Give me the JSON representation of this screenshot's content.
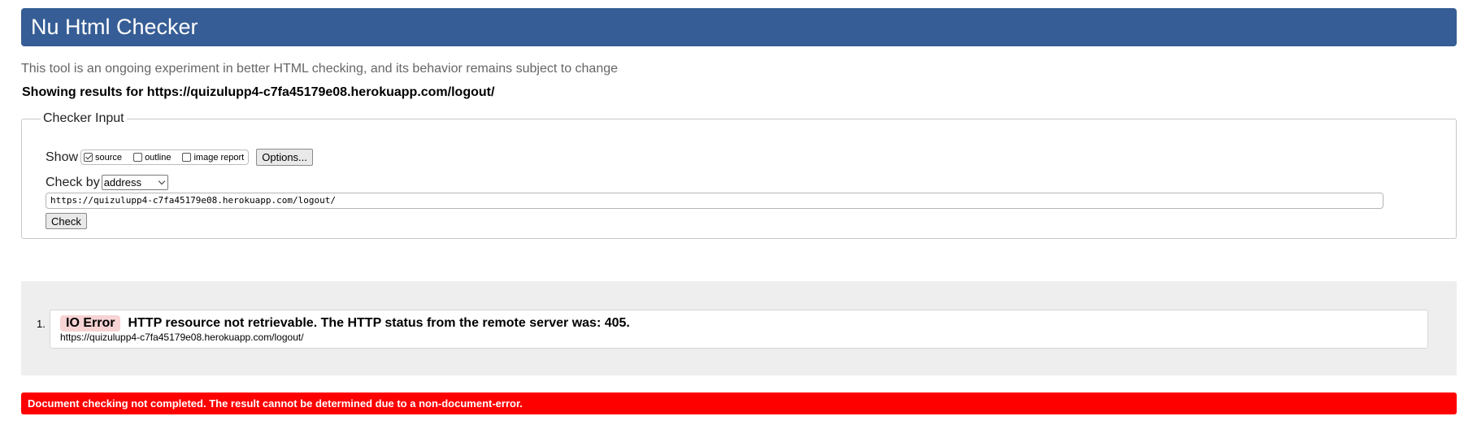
{
  "header": {
    "title": "Nu Html Checker"
  },
  "intro": "This tool is an ongoing experiment in better HTML checking, and its behavior remains subject to change",
  "showing": "Showing results for https://quizulupp4-c7fa45179e08.herokuapp.com/logout/",
  "checker_input": {
    "legend": "Checker Input",
    "show_label": "Show",
    "options": [
      {
        "label": "source",
        "checked": true
      },
      {
        "label": "outline",
        "checked": false
      },
      {
        "label": "image report",
        "checked": false
      }
    ],
    "options_button": "Options...",
    "check_by_label": "Check by",
    "check_by_value": "address",
    "url_value": "https://quizulupp4-c7fa45179e08.herokuapp.com/logout/",
    "check_button": "Check"
  },
  "results": [
    {
      "number": "1.",
      "type": "IO Error",
      "message": "HTTP resource not retrievable. The HTTP status from the remote server was: 405.",
      "url": "https://quizulupp4-c7fa45179e08.herokuapp.com/logout/"
    }
  ],
  "status": "Document checking not completed. The result cannot be determined due to a non-document-error.",
  "colors": {
    "header_bg": "#365d95",
    "error_badge_bg": "#f7d3d3",
    "status_bar_bg": "#ff0000",
    "results_bg": "#eeeeee"
  }
}
